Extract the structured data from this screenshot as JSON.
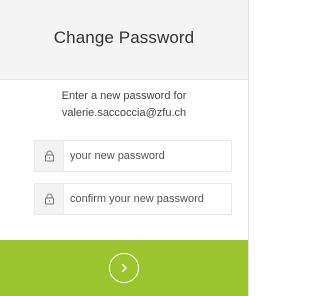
{
  "header": {
    "title": "Change Password"
  },
  "intro": {
    "line1": "Enter a new password for",
    "line2": "valerie.saccoccia@zfu.ch"
  },
  "form": {
    "new_password": {
      "placeholder": "your new password",
      "value": "",
      "icon": "lock-icon"
    },
    "confirm_password": {
      "placeholder": "confirm your new password",
      "value": "",
      "icon": "lock-icon"
    }
  },
  "footer": {
    "submit_icon": "chevron-right-circle-icon",
    "accent_color": "#9bc42e"
  }
}
